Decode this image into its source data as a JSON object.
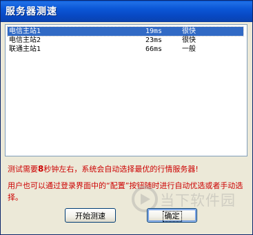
{
  "window": {
    "title": "服务器测速"
  },
  "server_list": {
    "rows": [
      {
        "name": "电信主站1",
        "ping": "19ms",
        "quality": "很快",
        "selected": true
      },
      {
        "name": "电信主站2",
        "ping": "23ms",
        "quality": "很快",
        "selected": false
      },
      {
        "name": "联通主站1",
        "ping": "66ms",
        "quality": "一般",
        "selected": false
      }
    ]
  },
  "notices": {
    "line1_prefix": "测试需要",
    "line1_number": "8",
    "line1_suffix": "秒钟左右，系统会自动选择最优的行情服务器!",
    "line2": "用户也可以通过登录界面中的“配置”按钮随时进行自动优选或者手动选择。"
  },
  "buttons": {
    "start_label": "开始测速",
    "ok_label": "确定"
  },
  "watermark": {
    "text": "当下软件园"
  },
  "colors": {
    "title_bar": "#0a4fd0",
    "notice_text": "#cc0000",
    "selection": "#316ac5"
  }
}
